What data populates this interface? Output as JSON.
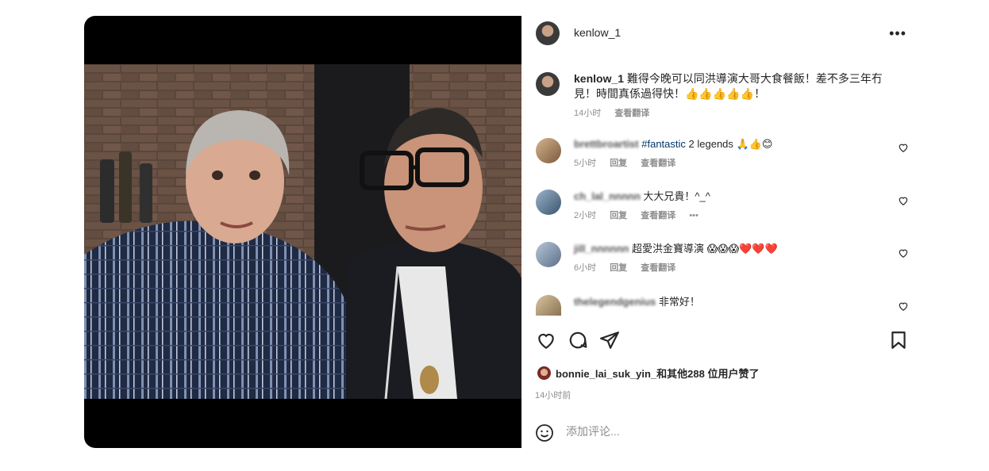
{
  "post": {
    "username": "kenlow_1",
    "more_label": "•••"
  },
  "caption": {
    "username": "kenlow_1",
    "text": "難得今晚可以同洪導演大哥大食餐飯！差不多三年冇見！時間真係過得快！👍👍👍👍👍！",
    "time": "14小时",
    "translate_label": "查看翻译"
  },
  "comments": [
    {
      "username": "brettbroartist",
      "hashtag": "#fantastic",
      "text": " 2 legends 🙏👍😊",
      "time": "5小时",
      "reply_label": "回复",
      "translate_label": "查看翻译"
    },
    {
      "username": "ch_lal_nnnnn",
      "text": "大大兄貴！^_^",
      "time": "2小时",
      "reply_label": "回复",
      "translate_label": "查看翻译",
      "more_label": "•••"
    },
    {
      "username": "jill_nnnnnn",
      "text": "超愛洪金寶導演 😱😱😱❤️❤️❤️",
      "time": "6小时",
      "reply_label": "回复",
      "translate_label": "查看翻译"
    },
    {
      "username": "thelegendgenius",
      "text": "非常好！"
    }
  ],
  "likes": {
    "text": "bonnie_lai_suk_yin_和其他288 位用户赞了",
    "time": "14小时前"
  },
  "add_comment": {
    "placeholder": "添加评论..."
  },
  "icons": [
    "like-icon",
    "comment-icon",
    "share-icon",
    "save-icon",
    "emoji-icon",
    "heart-icon",
    "more-icon"
  ]
}
